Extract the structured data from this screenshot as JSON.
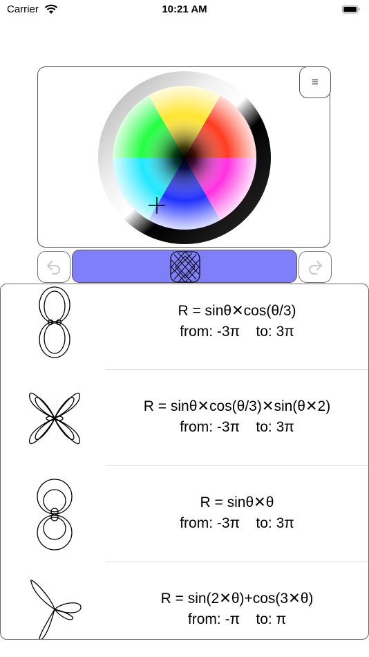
{
  "status_bar": {
    "carrier": "Carrier",
    "time": "10:21 AM"
  },
  "picker": {
    "menu_icon": "≡"
  },
  "accent_color": "#7f7ff9",
  "icons": {
    "undo": "undo-arrow-icon",
    "redo": "redo-arrow-icon",
    "menu": "hamburger-menu-icon"
  },
  "formulas": [
    {
      "equation": "R = sinθ✕cos(θ/3)",
      "from_label": "from:",
      "from": "-3π",
      "to_label": "to:",
      "to": "3π"
    },
    {
      "equation": "R = sinθ✕cos(θ/3)✕sin(θ✕2)",
      "from_label": "from:",
      "from": "-3π",
      "to_label": "to:",
      "to": "3π"
    },
    {
      "equation": "R = sinθ✕θ",
      "from_label": "from:",
      "from": "-3π",
      "to_label": "to:",
      "to": "3π"
    },
    {
      "equation": "R = sin(2✕θ)+cos(3✕θ)",
      "from_label": "from:",
      "from": "-π",
      "to_label": "to:",
      "to": "π"
    }
  ]
}
